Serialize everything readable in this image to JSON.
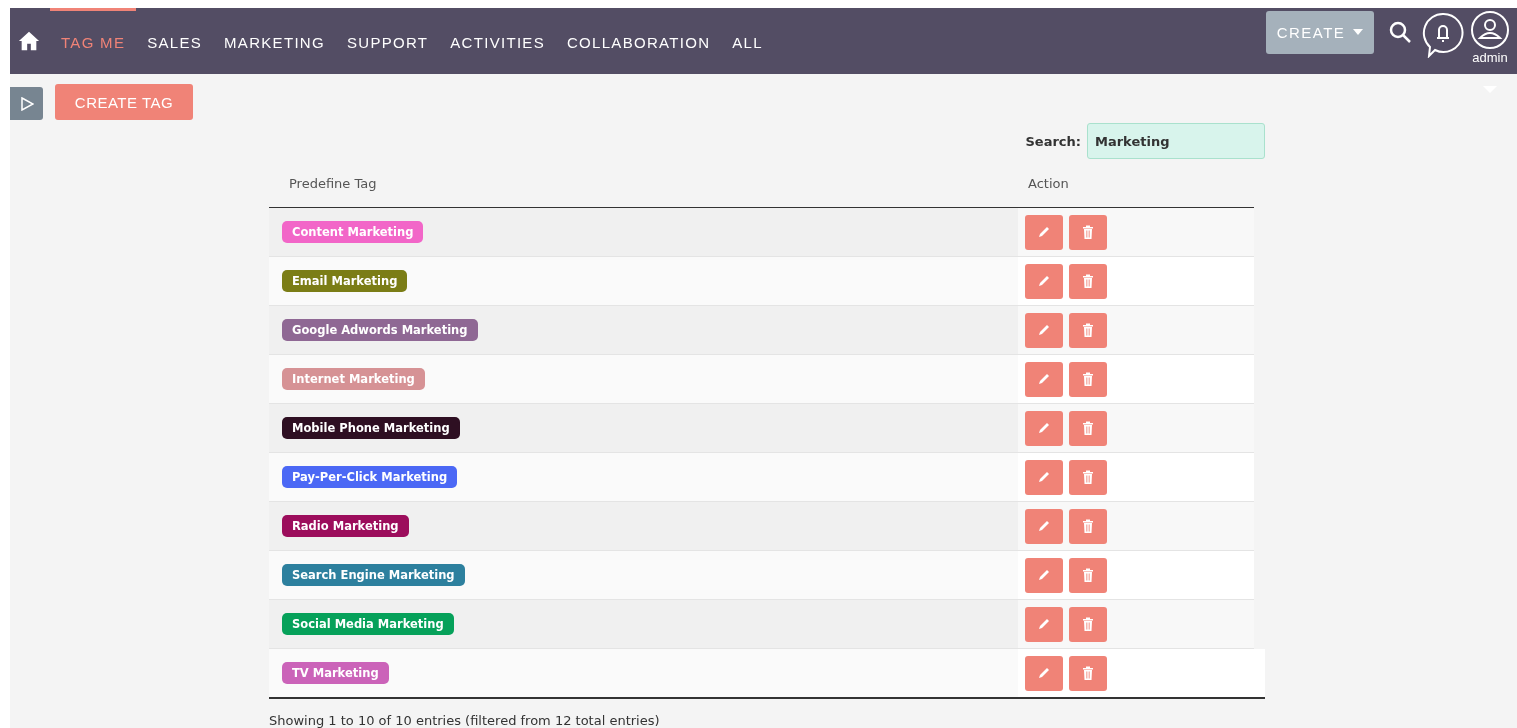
{
  "nav": {
    "items": [
      {
        "label": "TAG ME",
        "selected": true
      },
      {
        "label": "SALES",
        "selected": false
      },
      {
        "label": "MARKETING",
        "selected": false
      },
      {
        "label": "SUPPORT",
        "selected": false
      },
      {
        "label": "ACTIVITIES",
        "selected": false
      },
      {
        "label": "COLLABORATION",
        "selected": false
      },
      {
        "label": "ALL",
        "selected": false
      }
    ],
    "create_button": "CREATE",
    "user": "admin"
  },
  "create_tag_button": "CREATE TAG",
  "search": {
    "label": "Search:",
    "value": "Marketing"
  },
  "table": {
    "columns": [
      "Predefine Tag",
      "Action"
    ],
    "rows": [
      {
        "tag": "Content Marketing",
        "color": "#f266c8"
      },
      {
        "tag": "Email Marketing",
        "color": "#7b7d16"
      },
      {
        "tag": "Google Adwords Marketing",
        "color": "#8f6894"
      },
      {
        "tag": "Internet Marketing",
        "color": "#d69295"
      },
      {
        "tag": "Mobile Phone Marketing",
        "color": "#2e0f22"
      },
      {
        "tag": "Pay-Per-Click Marketing",
        "color": "#4b68f5"
      },
      {
        "tag": "Radio Marketing",
        "color": "#9c0d5c"
      },
      {
        "tag": "Search Engine Marketing",
        "color": "#2d809e"
      },
      {
        "tag": "Social Media Marketing",
        "color": "#06a15a"
      },
      {
        "tag": "TV Marketing",
        "color": "#cb63b9"
      }
    ]
  },
  "footer": "Showing 1 to 10 of 10 entries (filtered from 12 total entries)"
}
